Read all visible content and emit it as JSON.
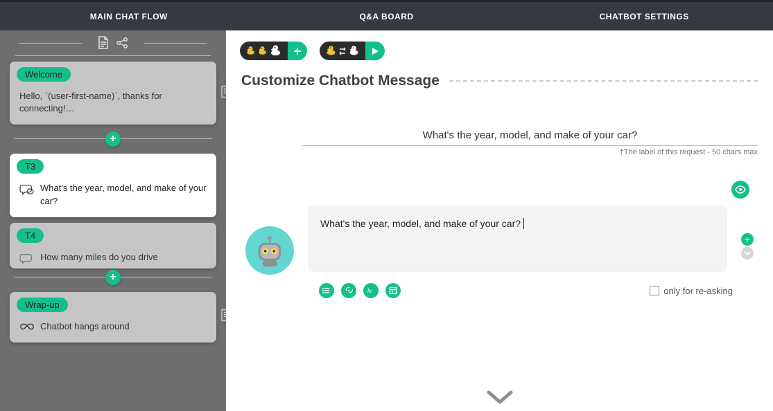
{
  "tabs": {
    "main": "MAIN CHAT FLOW",
    "qa": "Q&A BOARD",
    "settings": "CHATBOT SETTINGS"
  },
  "sidebar": {
    "cards": [
      {
        "badge": "Welcome",
        "text": "Hello, `(user-first-name)`, thanks for connecting!…"
      },
      {
        "badge": "T3",
        "text": "What's the year, model, and make of your car?"
      },
      {
        "badge": "T4",
        "text": "How many miles do you drive"
      },
      {
        "badge": "Wrap-up",
        "text": "Chatbot hangs around"
      }
    ]
  },
  "editor": {
    "section_title": "Customize Chatbot Message",
    "label_value": "What's the year, model, and make of your car?",
    "label_hint": "†The label of this request - 50 chars max",
    "bubble_text": "What's the year, model, and make of your car?",
    "reask_label": "only for re-asking"
  }
}
